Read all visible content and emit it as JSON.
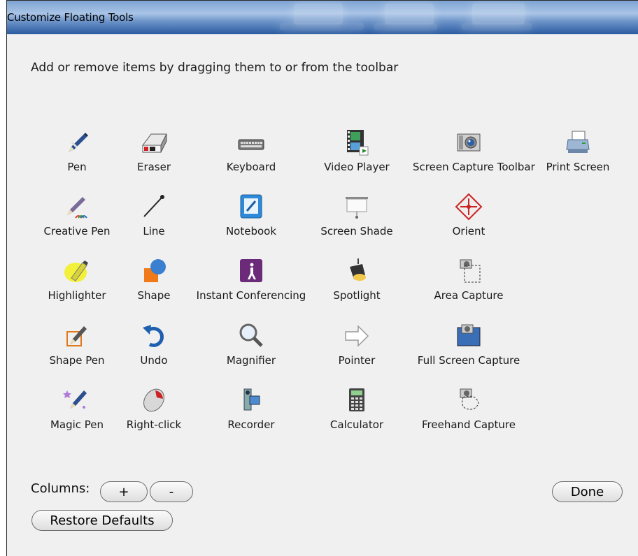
{
  "window": {
    "title": "Customize Floating Tools"
  },
  "instruction": "Add or remove items by dragging them to or from the toolbar",
  "tools": [
    {
      "label": "Pen",
      "icon": "pen-icon"
    },
    {
      "label": "Eraser",
      "icon": "eraser-icon"
    },
    {
      "label": "Keyboard",
      "icon": "keyboard-icon"
    },
    {
      "label": "Video Player",
      "icon": "video-player-icon"
    },
    {
      "label": "Screen Capture Toolbar",
      "icon": "camera-icon"
    },
    {
      "label": "Print Screen",
      "icon": "printer-icon"
    },
    {
      "label": "Creative Pen",
      "icon": "creative-pen-icon"
    },
    {
      "label": "Line",
      "icon": "line-icon"
    },
    {
      "label": "Notebook",
      "icon": "notebook-icon"
    },
    {
      "label": "Screen Shade",
      "icon": "screen-shade-icon"
    },
    {
      "label": "Orient",
      "icon": "orient-icon"
    },
    {
      "label": "Highlighter",
      "icon": "highlighter-icon"
    },
    {
      "label": "Shape",
      "icon": "shape-icon"
    },
    {
      "label": "Instant Conferencing",
      "icon": "instant-conferencing-icon"
    },
    {
      "label": "Spotlight",
      "icon": "spotlight-icon"
    },
    {
      "label": "Area Capture",
      "icon": "area-capture-icon"
    },
    {
      "label": "Shape Pen",
      "icon": "shape-pen-icon"
    },
    {
      "label": "Undo",
      "icon": "undo-icon"
    },
    {
      "label": "Magnifier",
      "icon": "magnifier-icon"
    },
    {
      "label": "Pointer",
      "icon": "pointer-arrow-icon"
    },
    {
      "label": "Full Screen Capture",
      "icon": "full-screen-capture-icon"
    },
    {
      "label": "Magic Pen",
      "icon": "magic-pen-icon"
    },
    {
      "label": "Right-click",
      "icon": "mouse-icon"
    },
    {
      "label": "Recorder",
      "icon": "recorder-icon"
    },
    {
      "label": "Calculator",
      "icon": "calculator-icon"
    },
    {
      "label": "Freehand Capture",
      "icon": "freehand-capture-icon"
    }
  ],
  "columns": {
    "label": "Columns:",
    "plus": "+",
    "minus": "-"
  },
  "buttons": {
    "restore": "Restore Defaults",
    "done": "Done"
  }
}
